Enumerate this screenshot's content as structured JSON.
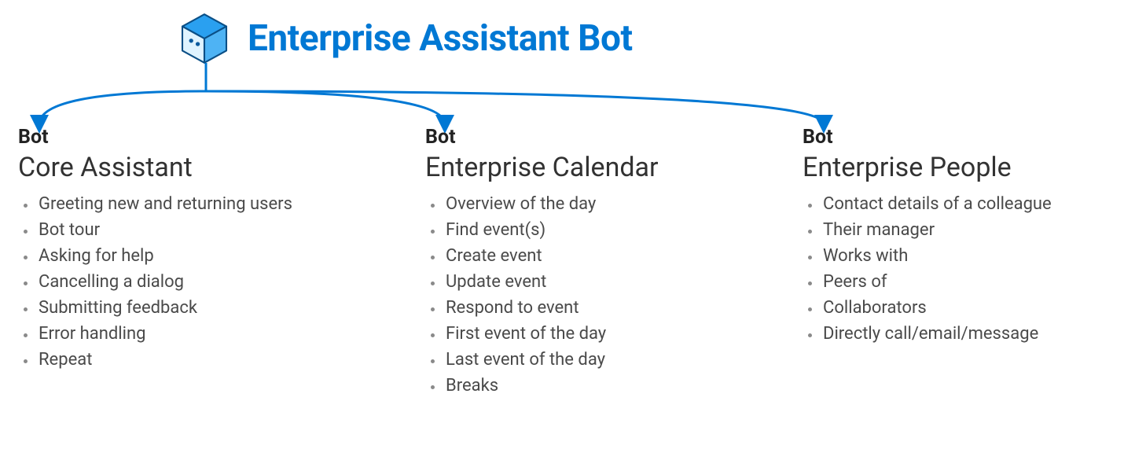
{
  "accent_color": "#0078D4",
  "title": "Enterprise Assistant Bot",
  "bots": [
    {
      "label": "Bot",
      "name": "Core Assistant",
      "features": [
        "Greeting new and returning users",
        "Bot tour",
        "Asking for help",
        "Cancelling a dialog",
        "Submitting feedback",
        "Error handling",
        "Repeat"
      ]
    },
    {
      "label": "Bot",
      "name": "Enterprise Calendar",
      "features": [
        "Overview of the day",
        "Find event(s)",
        "Create event",
        "Update event",
        "Respond to event",
        "First event of the day",
        "Last event of the day",
        "Breaks"
      ]
    },
    {
      "label": "Bot",
      "name": "Enterprise People",
      "features": [
        "Contact details of a colleague",
        "Their manager",
        "Works with",
        "Peers of",
        "Collaborators",
        "Directly call/email/message"
      ]
    }
  ]
}
